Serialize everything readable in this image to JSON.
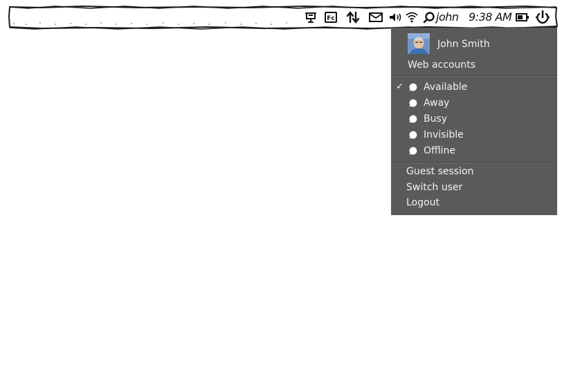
{
  "panel": {
    "username": "john",
    "clock": "9:38 AM",
    "icons": [
      "presentation-icon",
      "keyboard-layout-icon",
      "network-arrows-icon",
      "mail-icon",
      "volume-icon",
      "wifi-icon",
      "search-icon",
      "battery-icon",
      "power-icon"
    ],
    "keyboard_badge": "Fc"
  },
  "menu": {
    "user_name": "John Smith",
    "web_accounts": "Web accounts",
    "statuses": [
      {
        "label": "Available",
        "checked": true
      },
      {
        "label": "Away",
        "checked": false
      },
      {
        "label": "Busy",
        "checked": false
      },
      {
        "label": "Invisible",
        "checked": false
      },
      {
        "label": "Offline",
        "checked": false
      }
    ],
    "actions": {
      "guest": "Guest session",
      "switch": "Switch user",
      "logout": "Logout"
    },
    "check_glyph": "✓",
    "colors": {
      "menu_bg": "#5a5a5a",
      "menu_text": "#f2f2f2"
    }
  }
}
